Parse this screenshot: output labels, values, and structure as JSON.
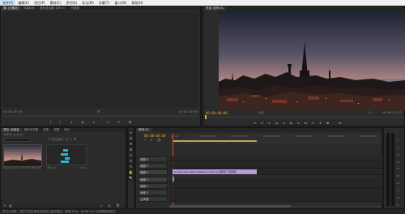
{
  "menu": [
    "文件(F)",
    "编辑(E)",
    "项目(P)",
    "素材(C)",
    "序列(S)",
    "标记(M)",
    "字幕(T)",
    "窗口(W)",
    "帮助(H)"
  ],
  "source_monitor": {
    "tabs": [
      "源: (无素材)",
      "效果控件",
      "音轨混合器: 序列 01",
      "元数据"
    ],
    "tc_left": "00:00:00:00",
    "tc_right": "00:00:00:00"
  },
  "program_monitor": {
    "tab": "节目: 序列 01",
    "tc_current": "00:00:00:00",
    "fit": "适合",
    "ratio": "1/2",
    "tc_duration": "00:00:12:22"
  },
  "project": {
    "tabs": [
      "项目: 未命名",
      "媒体浏览器",
      "信息",
      "效果",
      "标记",
      "历史记录"
    ],
    "project_file": "未命名.prproj",
    "item_count": "1 项已选择，共 2 项",
    "clip_name": "Sunset-Over-Tallinn-Estonia.mp4",
    "clip_duration": "12:22",
    "seq_label": "序列 01",
    "seq_duration": "12:22"
  },
  "timeline": {
    "tab": "序列 01",
    "tc": "00:00:00:00",
    "ruler": [
      "00:00",
      "00:00:05:00",
      "00:00:10:00",
      "00:00:15:00",
      "00:00:20:00",
      "00:00:25:00",
      "00:00:30:00"
    ],
    "tracks": [
      {
        "label": "V3",
        "name": "视频 3"
      },
      {
        "label": "V2",
        "name": "视频 2"
      },
      {
        "label": "V1",
        "name": "视频 1"
      },
      {
        "label": "A1",
        "name": "音频 1"
      },
      {
        "label": "A2",
        "name": "音频 2"
      },
      {
        "label": "A3",
        "name": "音频 3"
      },
      {
        "label": "主",
        "name": "主声道"
      }
    ],
    "video_clip": "Sunset-Over-Tallinn-Estonia.mp4 [V] 透明度:不透明度",
    "audio_clip": ""
  },
  "tools": [
    "▸",
    "⬌",
    "⇹",
    "⊞",
    "✂",
    "⇔",
    "✎",
    "✋",
    "🔍"
  ],
  "meter_scale": [
    "0",
    "-6",
    "-12",
    "-18",
    "-24",
    "-30",
    "-36",
    "-42",
    "-48",
    "-54",
    "dB"
  ],
  "status": "单击以选择，或在空白处单击并拖动以进行框选。使用 Shift、Alt 和 Ctrl 以获得其他选项。",
  "colors": {
    "accent_tc": "#e8a33b",
    "video_clip": "#b69ad9",
    "audio_clip": "#6ea7c4",
    "sky_top": "#1c2331",
    "sky_mid": "#8a6f7a",
    "sky_horizon": "#e9a17a"
  }
}
